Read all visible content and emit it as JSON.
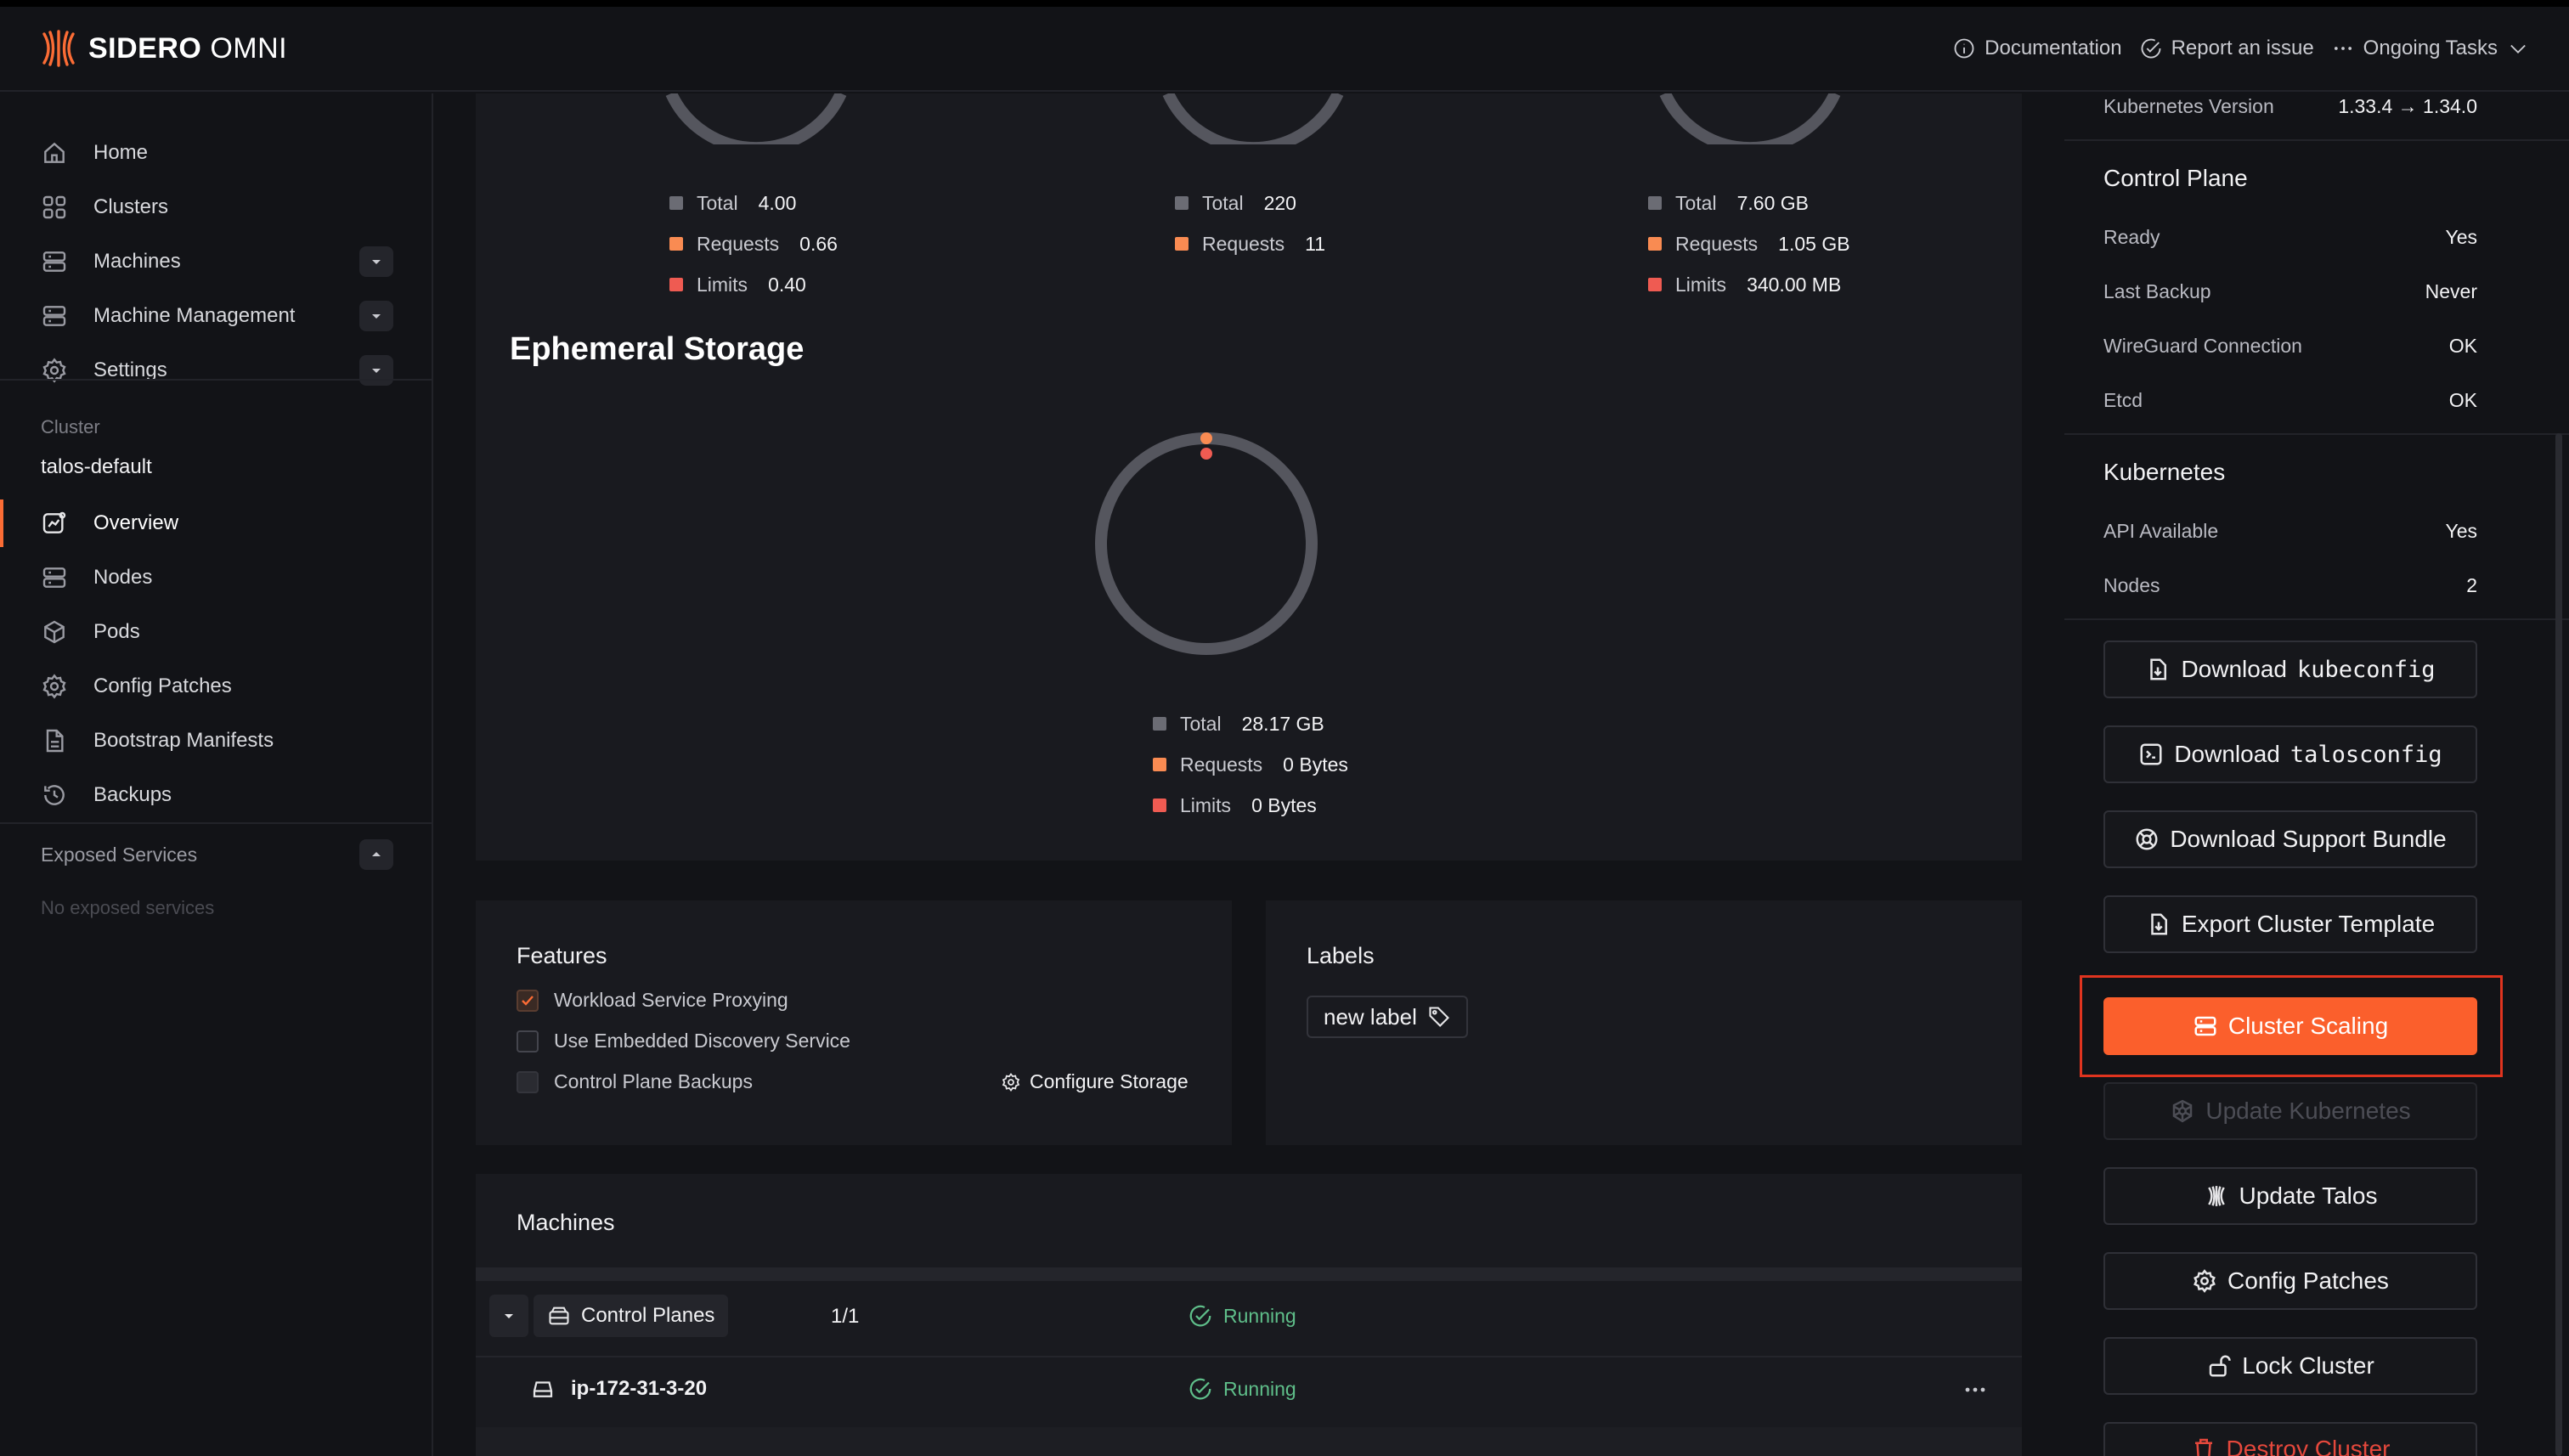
{
  "header": {
    "brand_bold": "SIDERO",
    "brand_light": "OMNI",
    "links": {
      "documentation": "Documentation",
      "report_issue": "Report an issue",
      "ongoing_tasks": "Ongoing Tasks"
    }
  },
  "sidebar": {
    "items": [
      {
        "label": "Home",
        "icon": "home-icon"
      },
      {
        "label": "Clusters",
        "icon": "grid-icon"
      },
      {
        "label": "Machines",
        "icon": "server-icon"
      },
      {
        "label": "Machine Management",
        "icon": "server-icon"
      },
      {
        "label": "Settings",
        "icon": "gear-icon"
      }
    ],
    "cluster_heading": "Cluster",
    "cluster_name": "talos-default",
    "cluster_items": [
      {
        "label": "Overview",
        "icon": "chart-icon"
      },
      {
        "label": "Nodes",
        "icon": "server-icon"
      },
      {
        "label": "Pods",
        "icon": "cube-icon"
      },
      {
        "label": "Config Patches",
        "icon": "gear-icon"
      },
      {
        "label": "Bootstrap Manifests",
        "icon": "file-icon"
      },
      {
        "label": "Backups",
        "icon": "history-icon"
      }
    ],
    "exposed_services_label": "Exposed Services",
    "no_exposed_services": "No exposed services"
  },
  "resources": {
    "cpu": {
      "total_label": "Total",
      "total": "4.00",
      "requests_label": "Requests",
      "requests": "0.66",
      "limits_label": "Limits",
      "limits": "0.40"
    },
    "pods": {
      "total_label": "Total",
      "total": "220",
      "requests_label": "Requests",
      "requests": "11"
    },
    "memory": {
      "total_label": "Total",
      "total": "7.60 GB",
      "requests_label": "Requests",
      "requests": "1.05 GB",
      "limits_label": "Limits",
      "limits": "340.00 MB"
    },
    "ephemeral": {
      "title": "Ephemeral Storage",
      "total_label": "Total",
      "total": "28.17 GB",
      "requests_label": "Requests",
      "requests": "0 Bytes",
      "limits_label": "Limits",
      "limits": "0 Bytes"
    }
  },
  "features": {
    "title": "Features",
    "items": [
      {
        "label": "Workload Service Proxying",
        "checked": true
      },
      {
        "label": "Use Embedded Discovery Service",
        "checked": false
      },
      {
        "label": "Control Plane Backups",
        "checked": false
      }
    ],
    "configure_storage": "Configure Storage"
  },
  "labels": {
    "title": "Labels",
    "new_label": "new label"
  },
  "machines": {
    "title": "Machines",
    "group_label": "Control Planes",
    "group_count": "1/1",
    "group_status": "Running",
    "rows": [
      {
        "name": "ip-172-31-3-20",
        "status": "Running"
      }
    ]
  },
  "details": {
    "kubernetes_version_label": "Kubernetes Version",
    "kubernetes_version": "1.33.4 → 1.34.0",
    "control_plane": {
      "title": "Control Plane",
      "rows": [
        {
          "k": "Ready",
          "v": "Yes"
        },
        {
          "k": "Last Backup",
          "v": "Never"
        },
        {
          "k": "WireGuard Connection",
          "v": "OK"
        },
        {
          "k": "Etcd",
          "v": "OK"
        }
      ]
    },
    "kubernetes": {
      "title": "Kubernetes",
      "rows": [
        {
          "k": "API Available",
          "v": "Yes"
        },
        {
          "k": "Nodes",
          "v": "2"
        }
      ]
    }
  },
  "actions": {
    "download_prefix": "Download",
    "kubeconfig": "kubeconfig",
    "talosconfig": "talosconfig",
    "support_bundle": "Download Support Bundle",
    "export_template": "Export Cluster Template",
    "cluster_scaling": "Cluster Scaling",
    "update_kubernetes": "Update Kubernetes",
    "update_talos": "Update Talos",
    "config_patches": "Config Patches",
    "lock_cluster": "Lock Cluster",
    "destroy_cluster": "Destroy Cluster"
  },
  "colors": {
    "accent": "#fb5f2c",
    "total": "#6b6c74",
    "requests": "#f98b52",
    "limits": "#ef5b52",
    "running": "#5fbf8a",
    "danger": "#e5483c"
  }
}
